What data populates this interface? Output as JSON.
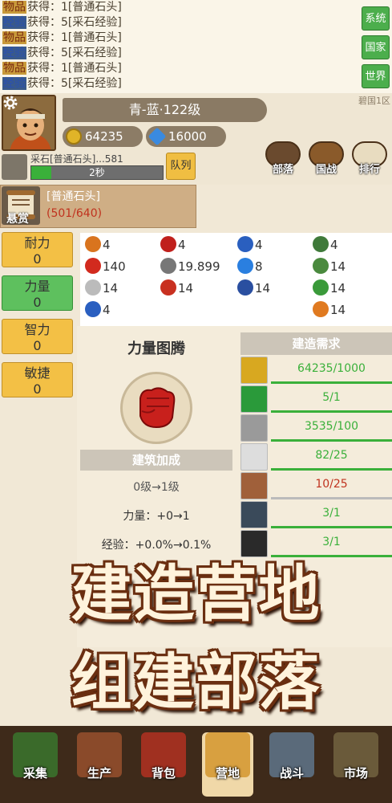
{
  "log": {
    "lines": [
      {
        "tag": "物品",
        "text": "获得：1[普通石头]"
      },
      {
        "tag": "经验",
        "text": "获得：5[采石经验]"
      },
      {
        "tag": "物品",
        "text": "获得：1[普通石头]"
      },
      {
        "tag": "经验",
        "text": "获得：5[采石经验]"
      },
      {
        "tag": "物品",
        "text": "获得：1[普通石头]"
      },
      {
        "tag": "经验",
        "text": "获得：5[采石经验]"
      }
    ],
    "side_buttons": [
      "系统",
      "国家",
      "世界"
    ],
    "region": "碧国1区"
  },
  "player": {
    "name": "青-蓝·122级",
    "gold": "64235",
    "diamond": "16000",
    "top_buttons": [
      "部落",
      "国战",
      "排行"
    ]
  },
  "work": {
    "label": "采石[普通石头]...581",
    "time": "2秒",
    "progress": 0.15,
    "queue_label": "队列"
  },
  "bounty": {
    "label": "悬赏",
    "item": "[普通石头]",
    "progress": "(501/640)"
  },
  "stats": [
    {
      "name": "耐力",
      "value": "0"
    },
    {
      "name": "力量",
      "value": "0"
    },
    {
      "name": "智力",
      "value": "0"
    },
    {
      "name": "敏捷",
      "value": "0"
    }
  ],
  "materials": [
    {
      "icon": "orange-rune-icon",
      "color": "#d9741e",
      "value": "4"
    },
    {
      "icon": "red-orb-icon",
      "color": "#c0201c",
      "value": "4"
    },
    {
      "icon": "blue-rune-icon",
      "color": "#2a5fbf",
      "value": "4"
    },
    {
      "icon": "green-rune-icon",
      "color": "#3f7a3a",
      "value": "4"
    },
    {
      "icon": "red-heart-icon",
      "color": "#d22a1e",
      "value": "140"
    },
    {
      "icon": "sword-icon",
      "color": "#777777",
      "value": "19.899"
    },
    {
      "icon": "blue-gear-icon",
      "color": "#2a7fe0",
      "value": "8"
    },
    {
      "icon": "green-shield-icon",
      "color": "#4a8a3e",
      "value": "14"
    },
    {
      "icon": "white-gem-icon",
      "color": "#bbbbbb",
      "value": "14"
    },
    {
      "icon": "red-dagger-icon",
      "color": "#c83020",
      "value": "14"
    },
    {
      "icon": "blue-star-icon",
      "color": "#2a4fa0",
      "value": "14"
    },
    {
      "icon": "green-leaf-icon",
      "color": "#3a9a3a",
      "value": "14"
    },
    {
      "icon": "blue-armor-icon",
      "color": "#2a5fc0",
      "value": "4"
    },
    {
      "icon": "orange-flame-icon",
      "color": "#e07a20",
      "value": "14"
    }
  ],
  "building": {
    "name": "力量图腾",
    "bonus_title": "建筑加成",
    "level_change": "0级→1级",
    "strength_change": "力量：+0→1",
    "exp_change": "经验：+0.0%→0.1%",
    "requirements_title": "建造需求",
    "requirements": [
      {
        "icon": "gold-coin-icon",
        "color": "#d8a820",
        "value": "64235/1000",
        "ok": true
      },
      {
        "icon": "green-crystal-icon",
        "color": "#2a9a3a",
        "value": "5/1",
        "ok": true
      },
      {
        "icon": "stone-icon",
        "color": "#9a9a9a",
        "value": "3535/100",
        "ok": true
      },
      {
        "icon": "white-ore-icon",
        "color": "#dddddd",
        "value": "82/25",
        "ok": true
      },
      {
        "icon": "bone-icon",
        "color": "#a0603a",
        "value": "10/25",
        "ok": false
      },
      {
        "icon": "dark-claw-icon",
        "color": "#3a4a5a",
        "value": "3/1",
        "ok": true
      },
      {
        "icon": "claw-icon",
        "color": "#2a2a2a",
        "value": "3/1",
        "ok": true
      }
    ]
  },
  "overlay": {
    "line1": "建造营地",
    "line2": "组建部落"
  },
  "nav": [
    {
      "label": "采集",
      "icon": "gather-icon"
    },
    {
      "label": "生产",
      "icon": "produce-icon"
    },
    {
      "label": "背包",
      "icon": "backpack-icon"
    },
    {
      "label": "营地",
      "icon": "camp-icon"
    },
    {
      "label": "战斗",
      "icon": "battle-icon"
    },
    {
      "label": "市场",
      "icon": "market-icon"
    }
  ],
  "colors": {
    "accent_green": "#3ab03a",
    "warning_red": "#c0321e",
    "stat_yellow": "#f3c045",
    "stat_green": "#5ec05e"
  }
}
